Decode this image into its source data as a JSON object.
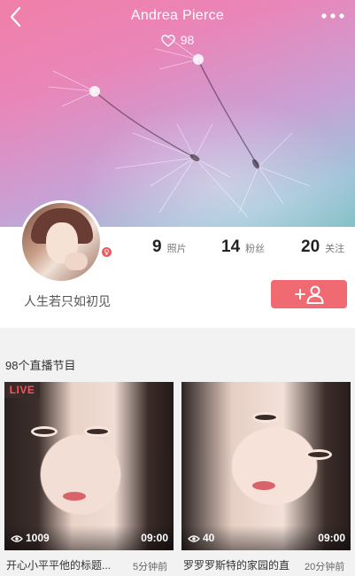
{
  "header": {
    "title": "Andrea Pierce",
    "likes": "98",
    "icons": {
      "back": "back-arrow-icon",
      "more": "more-dots-icon",
      "like": "heart-icon"
    }
  },
  "profile": {
    "signature": "人生若只如初见",
    "stats": [
      {
        "value": "9",
        "label": "照片"
      },
      {
        "value": "14",
        "label": "粉丝"
      },
      {
        "value": "20",
        "label": "关注"
      }
    ],
    "follow_icon": "add-user-icon",
    "gender_icon": "female-icon"
  },
  "section": {
    "title": "98个直播节目"
  },
  "streams": [
    {
      "live_label": "LIVE",
      "views": "1009",
      "duration": "09:00",
      "title": "开心小平平他的标题...",
      "time": "5分钟前"
    },
    {
      "views": "40",
      "duration": "09:00",
      "title": "罗罗罗斯特的家园的直",
      "time": "20分钟前"
    }
  ],
  "colors": {
    "accent": "#f06a71",
    "live": "#f0565d"
  }
}
